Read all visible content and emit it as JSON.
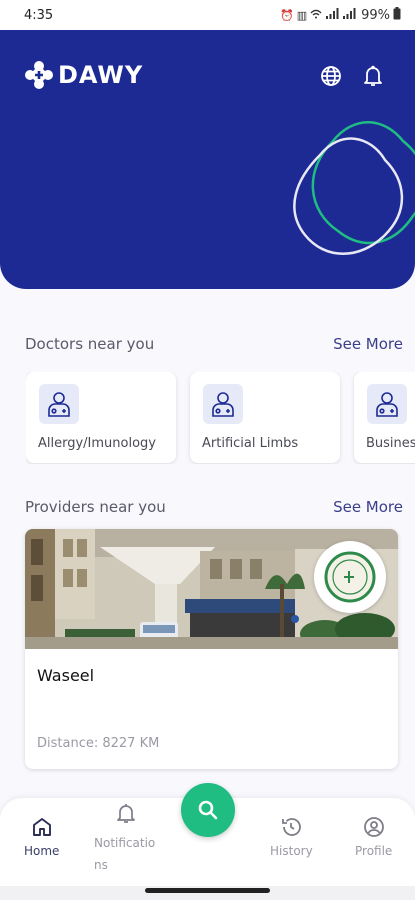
{
  "status_bar": {
    "time": "4:35",
    "battery": "99%",
    "icons": [
      "alarm-icon",
      "vibrate-icon",
      "signal-icon",
      "signal-icon"
    ]
  },
  "header": {
    "brand": "DAWY",
    "brand_color": "#1d2a94",
    "accent_color": "#1fbd82",
    "actions": [
      "globe-icon",
      "bell-icon"
    ]
  },
  "doctors": {
    "title": "Doctors near you",
    "see_more": "See More",
    "items": [
      {
        "label": "Allergy/Imunology",
        "icon": "doctor-icon"
      },
      {
        "label": "Artificial Limbs",
        "icon": "doctor-icon"
      },
      {
        "label": "Busines",
        "icon": "doctor-icon"
      }
    ]
  },
  "providers": {
    "title": "Providers near you",
    "see_more": "See More",
    "items": [
      {
        "name": "Waseel",
        "distance": "Distance: 8227 KM"
      }
    ]
  },
  "nav": {
    "home": "Home",
    "notifications": "Notifications",
    "history": "History",
    "profile": "Profile",
    "active": "Home"
  }
}
